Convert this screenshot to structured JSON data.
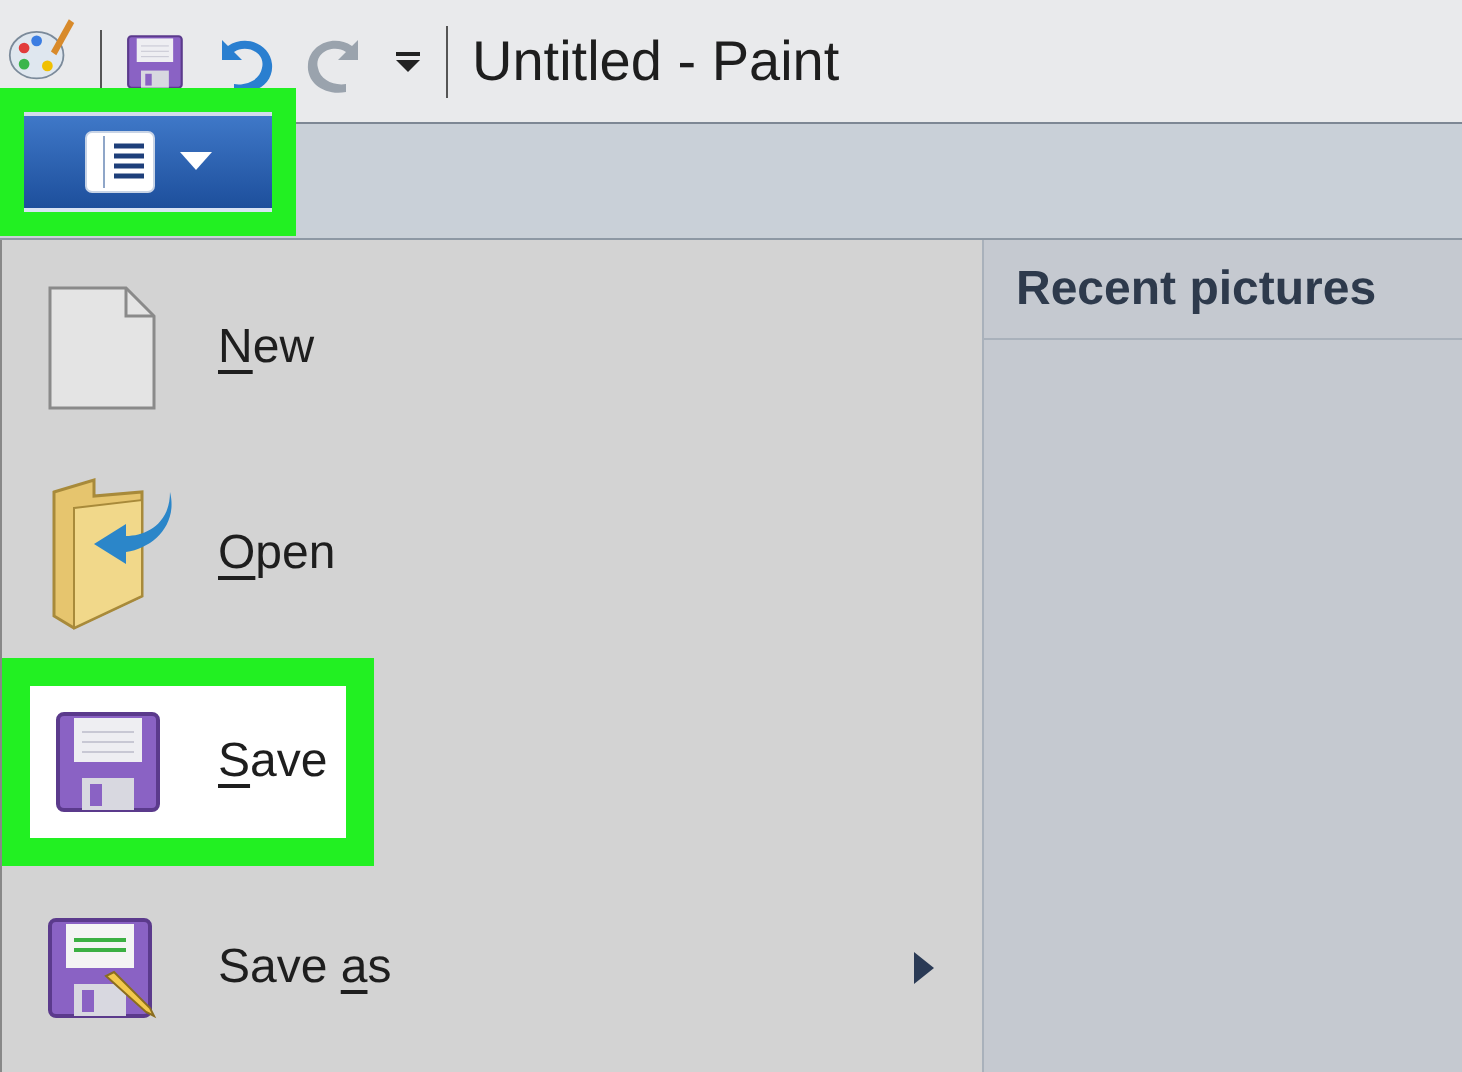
{
  "title_bar": {
    "title": "Untitled - Paint",
    "quick_access": [
      {
        "kind": "save",
        "disabled": false
      },
      {
        "kind": "undo",
        "disabled": false
      },
      {
        "kind": "redo",
        "disabled": true
      },
      {
        "kind": "customize",
        "disabled": false
      }
    ]
  },
  "file_menu_button": {
    "highlighted": true
  },
  "menu_items": [
    {
      "kind": "new",
      "label": [
        {
          "text": "N",
          "underlined": true
        },
        {
          "text": "ew",
          "underlined": false
        }
      ],
      "highlighted": false,
      "submenu": false
    },
    {
      "kind": "open",
      "label": [
        {
          "text": "O",
          "underlined": true
        },
        {
          "text": "pen",
          "underlined": false
        }
      ],
      "highlighted": false,
      "submenu": false
    },
    {
      "kind": "save",
      "label": [
        {
          "text": "S",
          "underlined": true
        },
        {
          "text": "ave",
          "underlined": false
        }
      ],
      "highlighted": true,
      "submenu": false
    },
    {
      "kind": "save_as",
      "label": [
        {
          "text": "Save ",
          "underlined": false
        },
        {
          "text": "a",
          "underlined": true
        },
        {
          "text": "s",
          "underlined": false
        }
      ],
      "highlighted": false,
      "submenu": true
    }
  ],
  "recent_panel": {
    "title": "Recent pictures"
  }
}
